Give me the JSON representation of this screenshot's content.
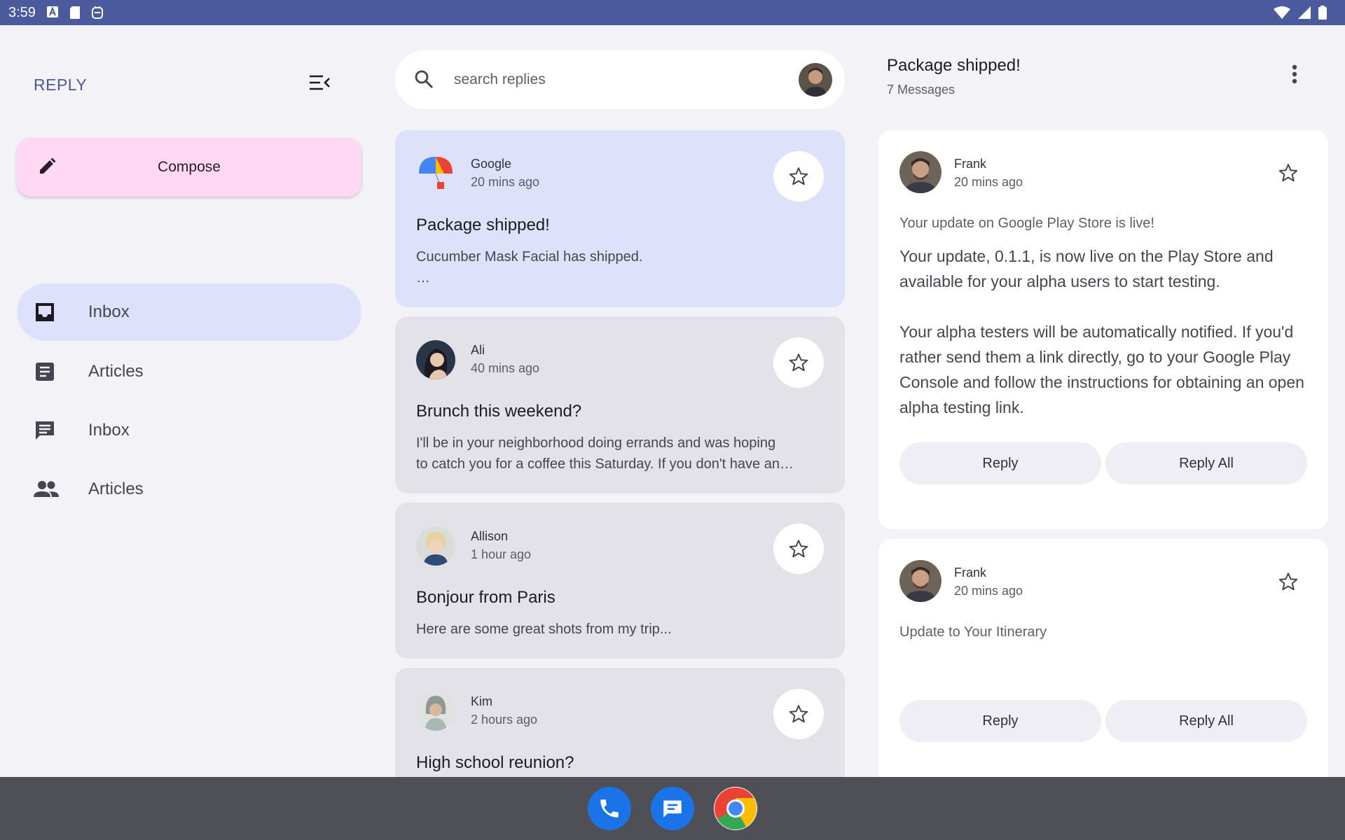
{
  "status_bar": {
    "time": "3:59"
  },
  "nav": {
    "brand": "REPLY",
    "compose_label": "Compose",
    "items": [
      {
        "label": "Inbox",
        "icon": "inbox-icon",
        "active": true
      },
      {
        "label": "Articles",
        "icon": "article-icon",
        "active": false
      },
      {
        "label": "Inbox",
        "icon": "chat-icon",
        "active": false
      },
      {
        "label": "Articles",
        "icon": "group-icon",
        "active": false
      }
    ]
  },
  "search": {
    "placeholder": "search replies"
  },
  "emails": [
    {
      "sender": "Google",
      "time": "20 mins ago",
      "subject": "Package shipped!",
      "preview": "Cucumber Mask Facial has shipped.",
      "preview2": "…",
      "selected": true
    },
    {
      "sender": "Ali",
      "time": "40 mins ago",
      "subject": "Brunch this weekend?",
      "preview": "I'll be in your neighborhood doing errands and was hoping",
      "preview2": "to catch you for a coffee this Saturday. If you don't have an…",
      "selected": false
    },
    {
      "sender": "Allison",
      "time": "1 hour ago",
      "subject": "Bonjour from Paris",
      "preview": "Here are some great shots from my trip...",
      "preview2": "",
      "selected": false
    },
    {
      "sender": "Kim",
      "time": "2 hours ago",
      "subject": "High school reunion?",
      "preview": "",
      "preview2": "",
      "selected": false
    }
  ],
  "detail": {
    "title": "Package shipped!",
    "count": "7 Messages",
    "messages": [
      {
        "sender": "Frank",
        "time": "20 mins ago",
        "subject": "Your update on Google Play Store is live!",
        "body": "Your update, 0.1.1, is now live on the Play Store and available for your alpha users to start testing.\n\nYour alpha testers will be automatically notified. If you'd rather send them a link directly, go to your Google Play Console and follow the instructions for obtaining an open alpha testing link.",
        "reply_label": "Reply",
        "reply_all_label": "Reply All"
      },
      {
        "sender": "Frank",
        "time": "20 mins ago",
        "subject": "Update to Your Itinerary",
        "body": "",
        "reply_label": "Reply",
        "reply_all_label": "Reply All"
      }
    ]
  },
  "colors": {
    "accent": "#4a5a9c",
    "compose": "#ffd8f4",
    "selected_card": "#dde1fa",
    "card": "#e3e2e9",
    "background": "#f3f2f7"
  }
}
